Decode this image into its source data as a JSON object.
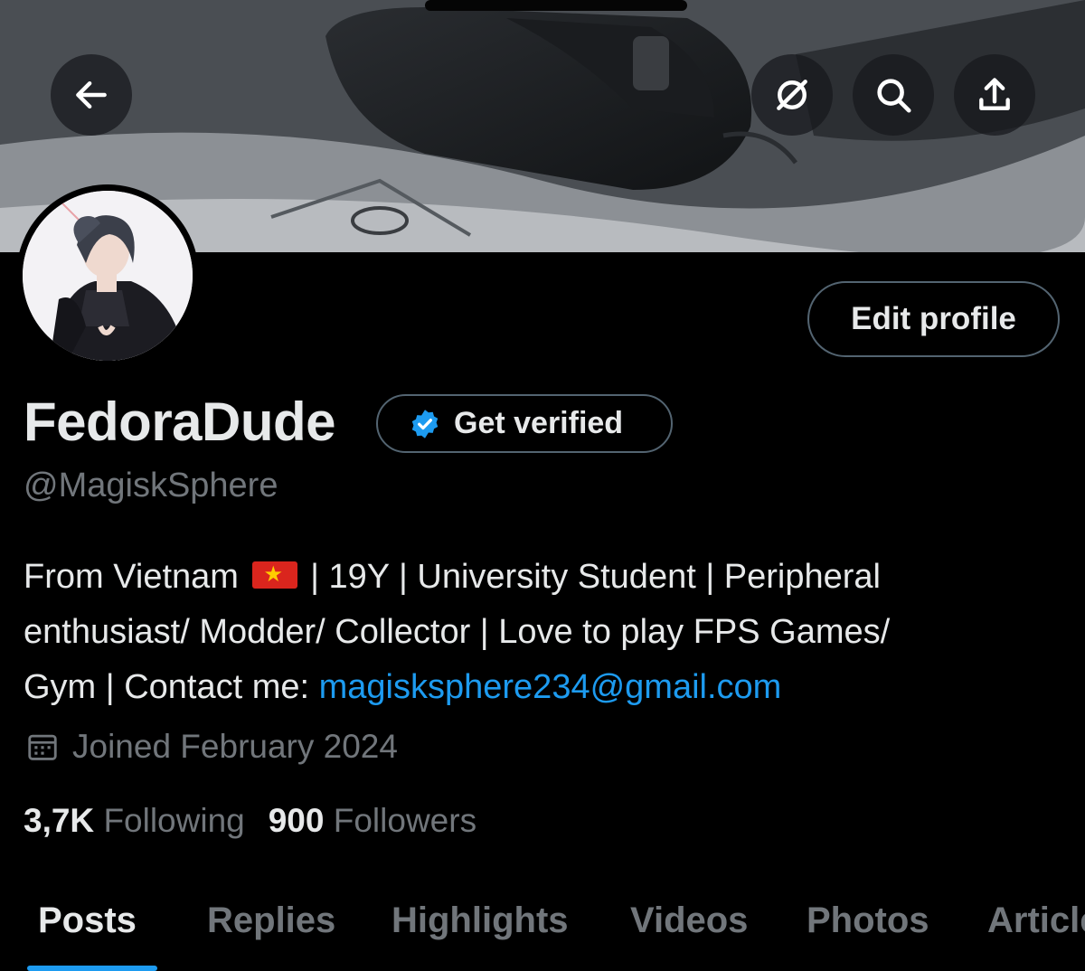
{
  "header": {
    "back_icon": "arrow-left-icon",
    "grok_icon": "slash-circle-icon",
    "search_icon": "search-icon",
    "share_icon": "share-icon"
  },
  "profile": {
    "edit_label": "Edit profile",
    "display_name": "FedoraDude",
    "verify_label": "Get verified",
    "handle": "@MagiskSphere",
    "bio_line1_a": "From Vietnam",
    "bio_line1_b": "| 19Y | University Student | Peripheral",
    "bio_line2": "enthusiast/ Modder/ Collector | Love to play FPS Games/",
    "bio_line3_a": "Gym | Contact me:",
    "bio_email": "magisksphere234@gmail.com",
    "joined": "Joined February 2024",
    "following_count": "3,7K",
    "following_label": "Following",
    "followers_count": "900",
    "followers_label": "Followers"
  },
  "tabs": [
    "Posts",
    "Replies",
    "Highlights",
    "Videos",
    "Photos",
    "Articles"
  ],
  "active_tab": "Posts",
  "colors": {
    "accent": "#1d9bf0",
    "background": "#000000",
    "muted_text": "#71767b",
    "border": "#536471"
  }
}
